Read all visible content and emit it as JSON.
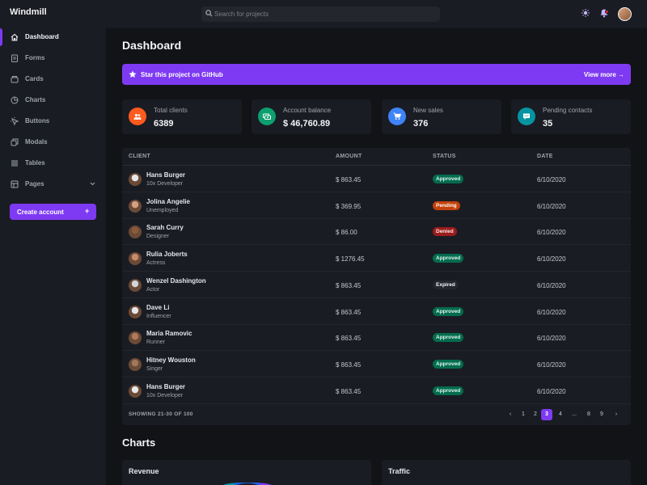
{
  "app": {
    "name": "Windmill"
  },
  "search": {
    "placeholder": "Search for projects"
  },
  "sidebar": {
    "items": [
      {
        "label": "Dashboard",
        "icon": "home-icon",
        "active": true
      },
      {
        "label": "Forms",
        "icon": "forms-icon"
      },
      {
        "label": "Cards",
        "icon": "cards-icon"
      },
      {
        "label": "Charts",
        "icon": "charts-icon"
      },
      {
        "label": "Buttons",
        "icon": "buttons-icon"
      },
      {
        "label": "Modals",
        "icon": "modals-icon"
      },
      {
        "label": "Tables",
        "icon": "tables-icon"
      },
      {
        "label": "Pages",
        "icon": "pages-icon",
        "has_submenu": true
      }
    ],
    "create_label": "Create account",
    "create_plus": "+"
  },
  "page": {
    "title": "Dashboard"
  },
  "banner": {
    "text": "Star this project on GitHub",
    "link": "View more →"
  },
  "stats": [
    {
      "title": "Total clients",
      "value": "6389",
      "color": "#ff5a1f",
      "icon": "users-icon"
    },
    {
      "title": "Account balance",
      "value": "$ 46,760.89",
      "color": "#0e9f6e",
      "icon": "money-icon"
    },
    {
      "title": "New sales",
      "value": "376",
      "color": "#3f83f8",
      "icon": "cart-icon"
    },
    {
      "title": "Pending contacts",
      "value": "35",
      "color": "#0694a2",
      "icon": "chat-icon"
    }
  ],
  "table": {
    "headers": [
      "CLIENT",
      "AMOUNT",
      "STATUS",
      "DATE"
    ],
    "rows": [
      {
        "name": "Hans Burger",
        "job": "10x Developer",
        "amount": "$ 863.45",
        "status": "Approved",
        "date": "6/10/2020"
      },
      {
        "name": "Jolina Angelie",
        "job": "Unemployed",
        "amount": "$ 369.95",
        "status": "Pending",
        "date": "6/10/2020"
      },
      {
        "name": "Sarah Curry",
        "job": "Designer",
        "amount": "$ 86.00",
        "status": "Denied",
        "date": "6/10/2020"
      },
      {
        "name": "Rulia Joberts",
        "job": "Actress",
        "amount": "$ 1276.45",
        "status": "Approved",
        "date": "6/10/2020"
      },
      {
        "name": "Wenzel Dashington",
        "job": "Actor",
        "amount": "$ 863.45",
        "status": "Expired",
        "date": "6/10/2020"
      },
      {
        "name": "Dave Li",
        "job": "Influencer",
        "amount": "$ 863.45",
        "status": "Approved",
        "date": "6/10/2020"
      },
      {
        "name": "Maria Ramovic",
        "job": "Runner",
        "amount": "$ 863.45",
        "status": "Approved",
        "date": "6/10/2020"
      },
      {
        "name": "Hitney Wouston",
        "job": "Singer",
        "amount": "$ 863.45",
        "status": "Approved",
        "date": "6/10/2020"
      },
      {
        "name": "Hans Burger",
        "job": "10x Developer",
        "amount": "$ 863.45",
        "status": "Approved",
        "date": "6/10/2020"
      }
    ],
    "showing": "SHOWING 21-30 OF 100",
    "pagination": [
      "‹",
      "1",
      "2",
      "3",
      "4",
      "...",
      "8",
      "9",
      "›"
    ],
    "current_page": "3"
  },
  "status_colors": {
    "Approved": {
      "bg": "#046c4e",
      "fg": "#def7ec"
    },
    "Pending": {
      "bg": "#c2410c",
      "fg": "#fff8f1"
    },
    "Denied": {
      "bg": "#9b1c1c",
      "fg": "#fde8e8"
    },
    "Expired": {
      "bg": "#24262d",
      "fg": "#f3f4f6"
    }
  },
  "charts": {
    "title": "Charts",
    "cards": [
      "Revenue",
      "Traffic"
    ]
  }
}
